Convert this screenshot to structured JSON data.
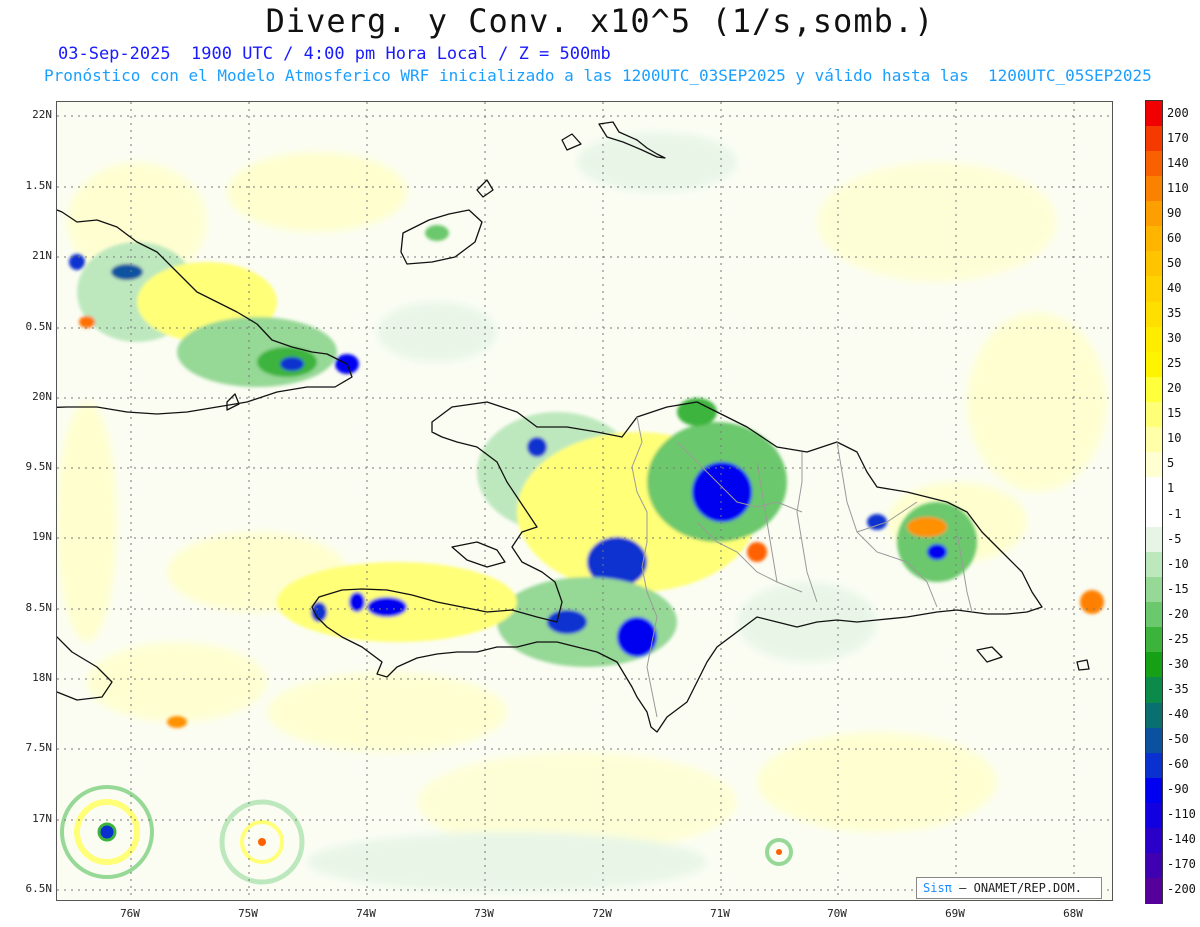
{
  "title": "Diverg. y Conv. x10^5 (1/s,somb.)",
  "subtitle_line1": "03-Sep-2025  1900 UTC / 4:00 pm Hora Local / Z = 500mb",
  "subtitle_line2": "Pronóstico con el Modelo Atmosferico WRF inicializado a las 1200UTC_03SEP2025 y válido hasta las  1200UTC_05SEP2025",
  "lat_labels": [
    "22N",
    "1.5N",
    "21N",
    "0.5N",
    "20N",
    "9.5N",
    "19N",
    "8.5N",
    "18N",
    "7.5N",
    "17N",
    "6.5N"
  ],
  "lon_labels": [
    "76W",
    "75W",
    "74W",
    "73W",
    "72W",
    "71W",
    "70W",
    "69W",
    "68W"
  ],
  "colorbar": {
    "labels": [
      "200",
      "170",
      "140",
      "110",
      "90",
      "60",
      "50",
      "40",
      "35",
      "30",
      "25",
      "20",
      "15",
      "10",
      "5",
      "1",
      "-1",
      "-5",
      "-10",
      "-15",
      "-20",
      "-25",
      "-30",
      "-35",
      "-40",
      "-50",
      "-60",
      "-90",
      "-110",
      "-140",
      "-170",
      "-200"
    ],
    "colors": [
      "#f00000",
      "#f53a00",
      "#f86000",
      "#fb8200",
      "#fd9f00",
      "#ffb400",
      "#ffc400",
      "#ffd200",
      "#ffdf00",
      "#ffec00",
      "#fff400",
      "#ffff3c",
      "#ffff78",
      "#ffffaa",
      "#ffffd2",
      "#ffffff",
      "#ffffff",
      "#e6f5e6",
      "#bde8bd",
      "#96d896",
      "#6cc86c",
      "#3cb43c",
      "#16a016",
      "#0b8a4a",
      "#0a6f6f",
      "#0a52a0",
      "#0a30d0",
      "#0000f0",
      "#1200e0",
      "#2a00c8",
      "#3e00b0",
      "#55009a"
    ]
  },
  "credit": {
    "logo": "Sisπ",
    "text": "– ONAMET/REP.DOM."
  }
}
